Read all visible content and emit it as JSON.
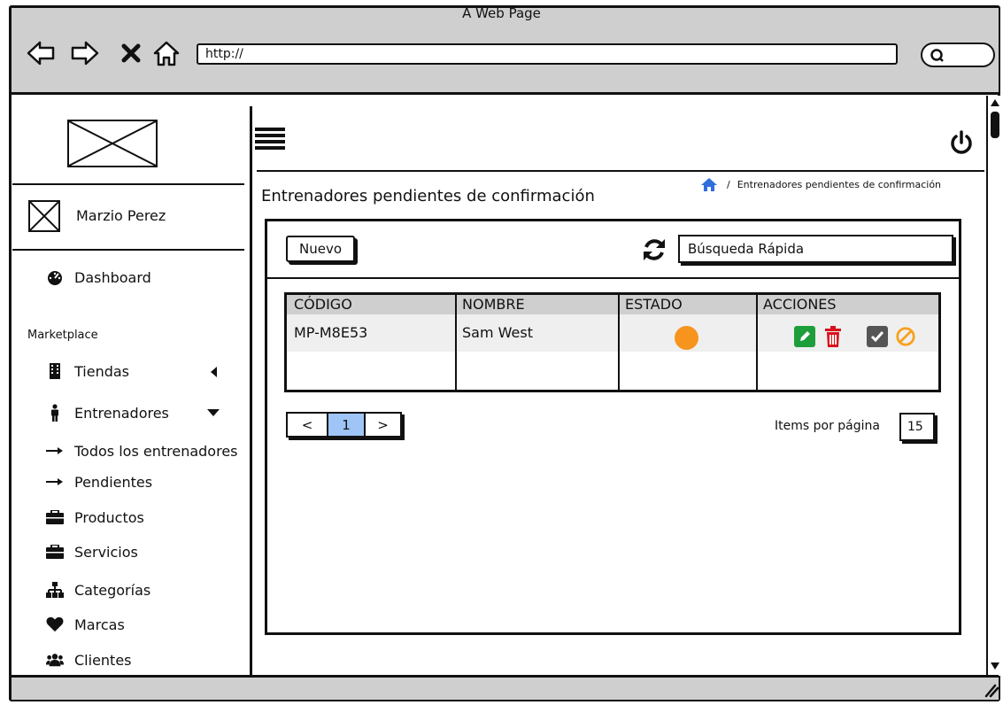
{
  "window": {
    "title": "A Web Page"
  },
  "browser": {
    "url": "http://"
  },
  "sidebar": {
    "user_name": "Marzio Perez",
    "dashboard_label": "Dashboard",
    "section_label": "Marketplace",
    "items": [
      {
        "label": "Tiendas",
        "icon": "building-icon"
      },
      {
        "label": "Entrenadores",
        "icon": "person-icon"
      },
      {
        "label": "Todos los entrenadores",
        "icon": "arrow-right-icon"
      },
      {
        "label": "Pendientes",
        "icon": "arrow-right-icon"
      },
      {
        "label": "Productos",
        "icon": "briefcase-icon"
      },
      {
        "label": "Servicios",
        "icon": "briefcase-icon"
      },
      {
        "label": "Categorías",
        "icon": "sitemap-icon"
      },
      {
        "label": "Marcas",
        "icon": "heart-icon"
      },
      {
        "label": "Clientes",
        "icon": "users-icon"
      }
    ]
  },
  "page": {
    "title": "Entrenadores pendientes de confirmación",
    "breadcrumb": "Entrenadores pendientes de confirmación",
    "breadcrumb_separator": "/"
  },
  "toolbar": {
    "new_label": "Nuevo",
    "search_value": "Búsqueda Rápida"
  },
  "table": {
    "headers": [
      "CÓDIGO",
      "NOMBRE",
      "ESTADO",
      "ACCIONES"
    ],
    "rows": [
      {
        "codigo": "MP-M8E53",
        "nombre": "Sam West",
        "estado": "pending"
      }
    ]
  },
  "pagination": {
    "prev": "<",
    "current": "1",
    "next": ">",
    "items_label": "Items por página",
    "items_value": "15"
  },
  "colors": {
    "status_pending": "#f7941d",
    "edit": "#1e9e3a",
    "delete": "#d8121b",
    "approve": "#555555",
    "reject": "#f7a21d",
    "home": "#2f6fdc",
    "page_active": "#9ec5f5"
  }
}
